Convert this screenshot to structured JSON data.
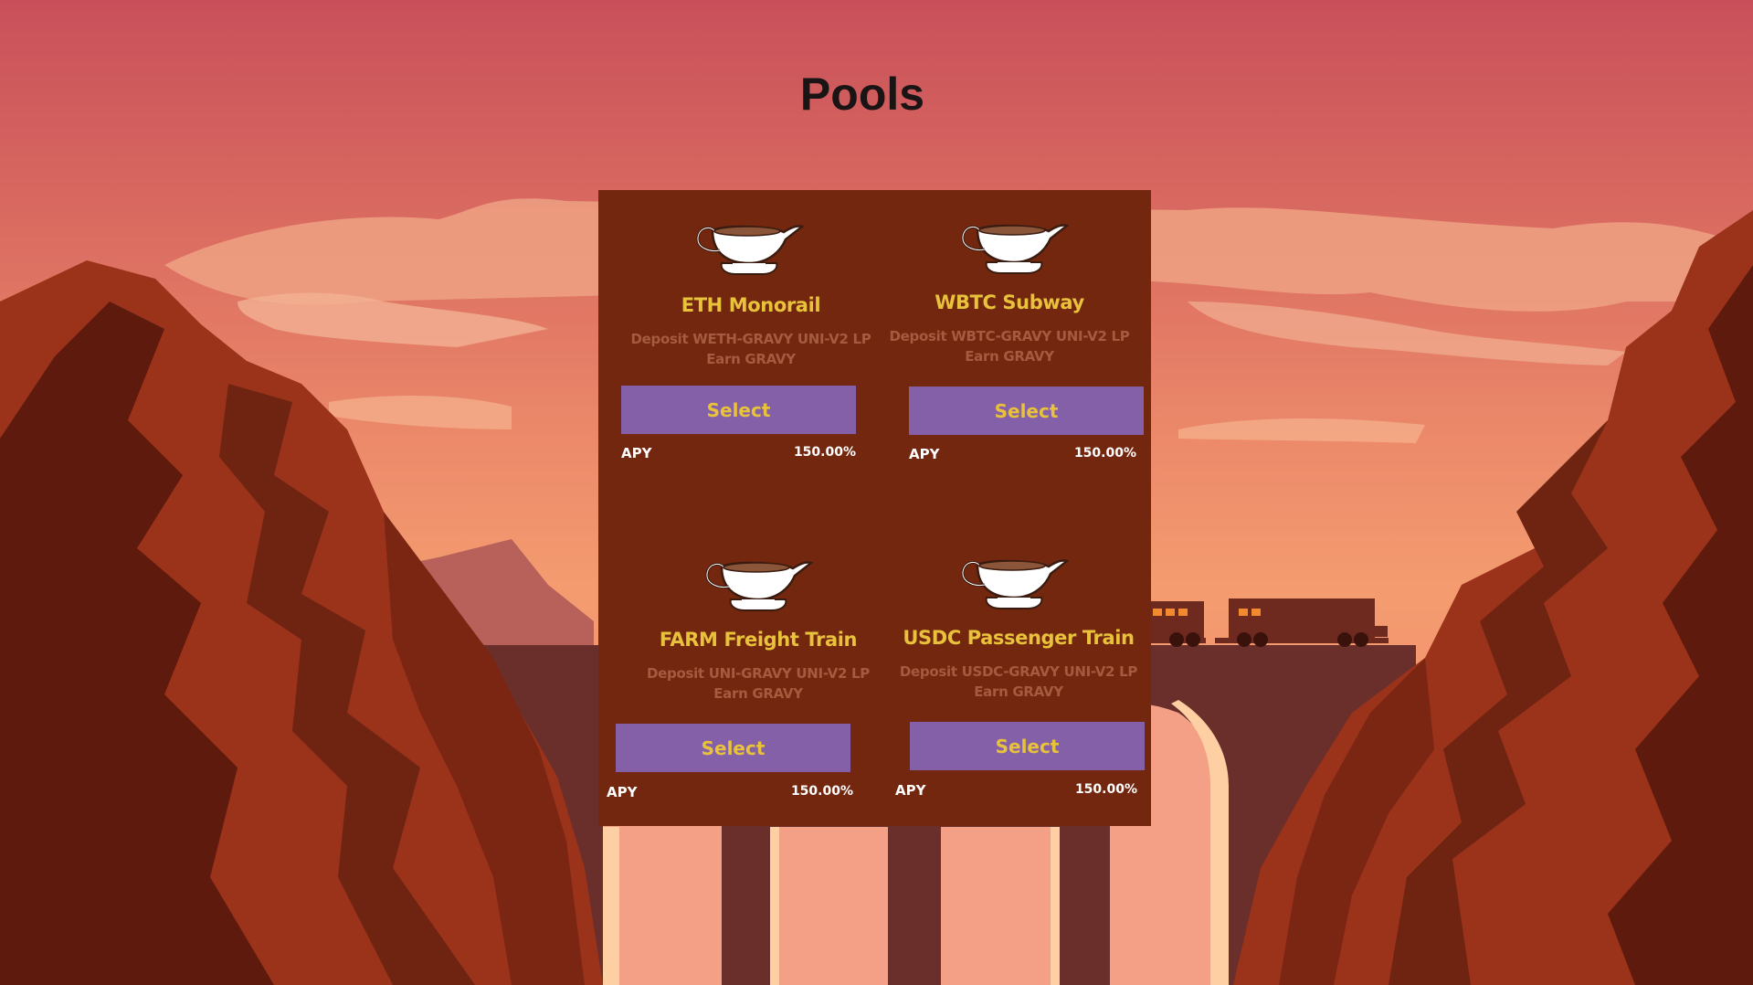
{
  "page": {
    "title": "Pools"
  },
  "pools": [
    {
      "name": "ETH Monorail",
      "deposit": "Deposit WETH-GRAVY UNI-V2 LP",
      "earn": "Earn GRAVY",
      "button_label": "Select",
      "apy_label": "APY",
      "apy_value": "150.00%"
    },
    {
      "name": "WBTC Subway",
      "deposit": "Deposit WBTC-GRAVY UNI-V2 LP",
      "earn": "Earn GRAVY",
      "button_label": "Select",
      "apy_label": "APY",
      "apy_value": "150.00%"
    },
    {
      "name": "FARM Freight Train",
      "deposit": "Deposit UNI-GRAVY UNI-V2 LP",
      "earn": "Earn GRAVY",
      "button_label": "Select",
      "apy_label": "APY",
      "apy_value": "150.00%"
    },
    {
      "name": "USDC Passenger Train",
      "deposit": "Deposit USDC-GRAVY UNI-V2 LP",
      "earn": "Earn GRAVY",
      "button_label": "Select",
      "apy_label": "APY",
      "apy_value": "150.00%"
    }
  ],
  "icons": {
    "pool_icon": "gravy-boat-icon"
  },
  "colors": {
    "panel": "#74270f",
    "accent": "#e9c23b",
    "button": "#8460a9",
    "muted_text": "#a45b3e"
  }
}
